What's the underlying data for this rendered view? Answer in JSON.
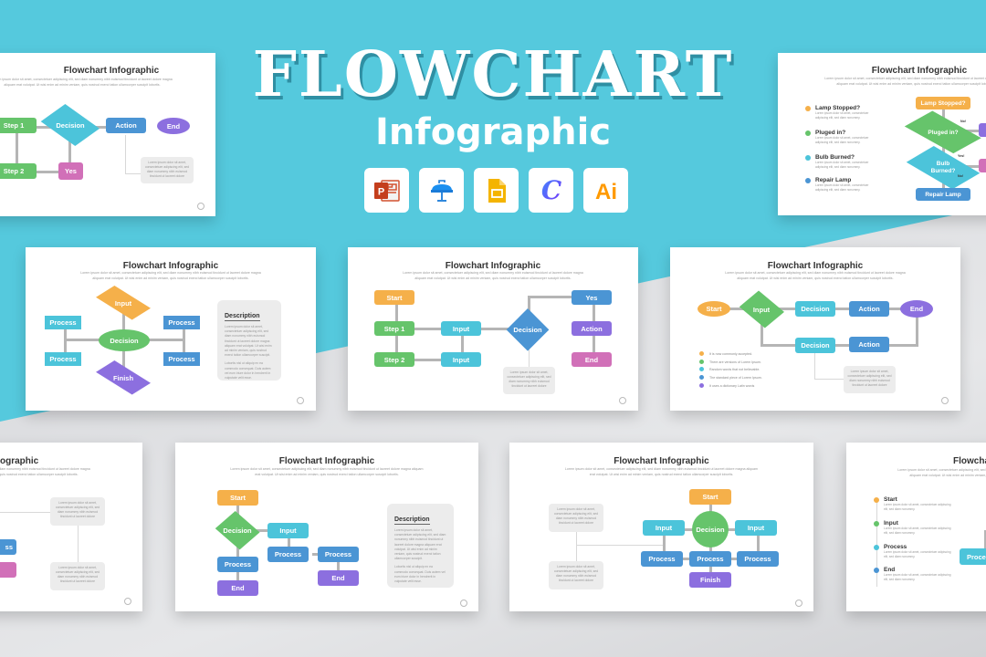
{
  "hero": {
    "title": "FLOWCHART",
    "subtitle": "Infographic",
    "apps": [
      "PowerPoint",
      "Keynote",
      "Google Slides",
      "Canva",
      "Illustrator"
    ]
  },
  "colors": {
    "teal_bg": "#55c9dd",
    "orange": "#f5b04a",
    "green": "#66c46b",
    "cyan": "#4cc4da",
    "blue": "#4b95d4",
    "purple": "#8c6fdf",
    "pink": "#d170b8"
  },
  "common": {
    "slide_title": "Flowchart Infographic",
    "lorem_intro": "Lorem ipsum dolor sit amet, consectetuer adipiscing elit, sed diam nonummy nibh euismod tincidunt ut laoreet dolore magna aliquam erat volutpat. Ut wisi enim ad minim veniam, quis nostrud exerci tation ullamcorper suscipit lobortis.",
    "note_text": "Lorem ipsum dolor sit amet, consectetuer adipiscing elit, sed diam nonummy nibh euismod tincidunt ut laoreet dolore",
    "desc_heading": "Description",
    "desc_p1": "Lorem ipsum dolor sit amet, consectetuer adipiscing elit, sed diam nonummy nibh euismod tincidunt ut laoreet dolore magna aliquam erat volutpat. Ut wisi enim ad minim veniam, quis nostrud exerci tation ullamcorper suscipit.",
    "desc_p2": "Lobortis nisl ut aliquip ex ea commodo consequat. Duis autem vel eum iriure dolor in hendrerit in vulputate velit esse.",
    "short_text": "Lorem ipsum dolor sit amet, consectetuer adipiscing elit, sed diam nonummy."
  },
  "slide1": {
    "nodes": [
      "Step 1",
      "Decision",
      "Action",
      "End",
      "Step 2",
      "Yes"
    ]
  },
  "slide2": {
    "list": [
      "Lamp Stopped?",
      "Pluged in?",
      "Bulb Burned?",
      "Repair Lamp"
    ],
    "nodes": [
      "Lamp Stopped?",
      "Pluged in?",
      "Bulb Burned?",
      "Repair Lamp"
    ],
    "labels": [
      "No!",
      "Yes!",
      "No!"
    ]
  },
  "slide3": {
    "nodes": [
      "Input",
      "Process",
      "Decision",
      "Process",
      "Process",
      "Process",
      "Finish"
    ]
  },
  "slide4": {
    "nodes": [
      "Start",
      "Step 1",
      "Input",
      "Decision",
      "Yes",
      "Step 2",
      "Input",
      "Action",
      "End"
    ]
  },
  "slide5": {
    "nodes": [
      "Start",
      "Input",
      "Decision",
      "Action",
      "End",
      "Decision",
      "Action"
    ],
    "bullets": [
      "It is now commonly accepted.",
      "There are versions of Lorem Ipsum.",
      "Random words that not believable.",
      "The standard piece of Lorem Ipsum.",
      "It uses a dictionary Latin words"
    ]
  },
  "slide6": {
    "title_fragment": "ographic",
    "nodes": [
      "ss",
      ""
    ]
  },
  "slide7": {
    "nodes": [
      "Start",
      "Decision",
      "Input",
      "Process",
      "Process",
      "Process",
      "End",
      "End"
    ]
  },
  "slide8": {
    "nodes": [
      "Start",
      "Input",
      "Decision",
      "Input",
      "Process",
      "Process",
      "Process",
      "Finish"
    ]
  },
  "slide9": {
    "title_fragment": "Flowcha",
    "list": [
      "Start",
      "Input",
      "Process",
      "End"
    ],
    "nodes": [
      "Proce"
    ]
  }
}
